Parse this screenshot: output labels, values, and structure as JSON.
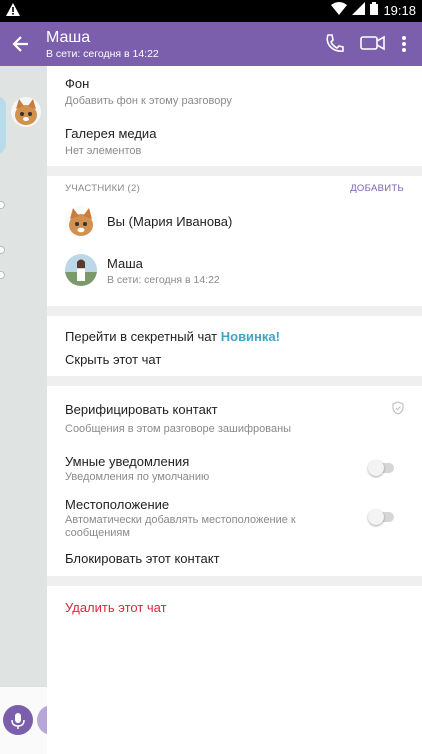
{
  "status_bar": {
    "time": "19:18"
  },
  "header": {
    "title": "Маша",
    "subtitle": "В сети: сегодня в 14:22"
  },
  "settings": {
    "background": {
      "title": "Фон",
      "subtitle": "Добавить фон к этому разговору"
    },
    "media_gallery": {
      "title": "Галерея медиа",
      "subtitle": "Нет элементов"
    }
  },
  "participants": {
    "header": "УЧАСТНИКИ (2)",
    "add_label": "ДОБАВИТЬ",
    "items": [
      {
        "name": "Вы (Мария Иванова)",
        "status": ""
      },
      {
        "name": "Маша",
        "status": "В сети: сегодня в 14:22"
      }
    ]
  },
  "actions": {
    "secret_chat": "Перейти в секретный чат",
    "new_badge": "Новинка!",
    "hide_chat": "Скрыть этот чат"
  },
  "security": {
    "verify": {
      "title": "Верифицировать контакт",
      "subtitle": "Сообщения в этом разговоре зашифрованы"
    },
    "smart_notifications": {
      "title": "Умные уведомления",
      "subtitle": "Уведомления по умолчанию",
      "enabled": false
    },
    "location": {
      "title": "Местоположение",
      "subtitle_line1": "Автоматически добавлять местоположение к",
      "subtitle_line2": "сообщениям",
      "enabled": false
    },
    "block": "Блокировать этот контакт"
  },
  "danger": {
    "delete_chat": "Удалить этот чат"
  },
  "colors": {
    "accent": "#7b5fad",
    "danger": "#e0243a",
    "link": "#3fa5c7"
  }
}
